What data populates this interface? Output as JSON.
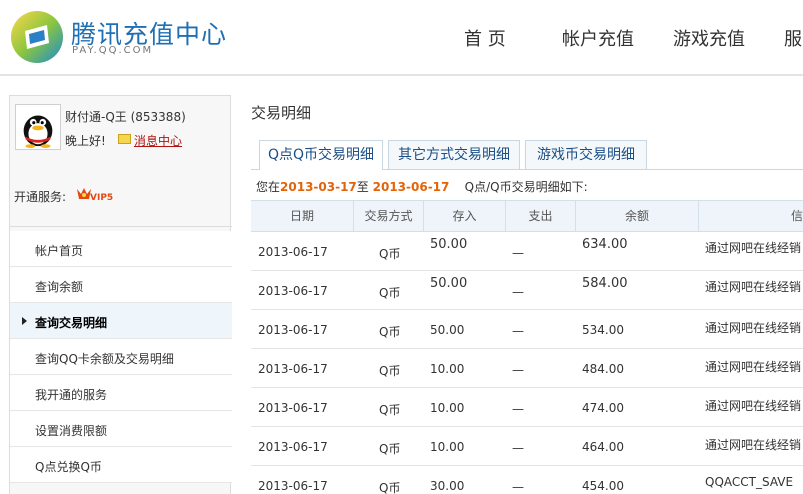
{
  "header": {
    "logo_text": "腾讯充值中心",
    "logo_sub": "PAY.QQ.COM",
    "nav": [
      "首 页",
      "帐户充值",
      "游戏充值",
      "服务"
    ]
  },
  "sidebar": {
    "user_name": "财付通-Q王 (853388)",
    "greeting": "晚上好!",
    "message_link": "消息中心",
    "service_label": "开通服务:",
    "vip_badge": "VIP5",
    "menu": [
      {
        "label": "帐户首页",
        "selected": false
      },
      {
        "label": "查询余额",
        "selected": false
      },
      {
        "label": "查询交易明细",
        "selected": true
      },
      {
        "label": "查询QQ卡余额及交易明细",
        "selected": false
      },
      {
        "label": "我开通的服务",
        "selected": false
      },
      {
        "label": "设置消费限额",
        "selected": false
      },
      {
        "label": "Q点兑换Q币",
        "selected": false
      }
    ]
  },
  "main": {
    "title": "交易明细",
    "tabs": [
      "Q点Q币交易明细",
      "其它方式交易明细",
      "游戏币交易明细"
    ],
    "date_prefix": "您在",
    "date_from": "2013-03-17",
    "date_mid": "至",
    "date_to": "2013-06-17",
    "date_suffix": "Q点/Q币交易明细如下:",
    "columns": [
      "日期",
      "交易方式",
      "存入",
      "支出",
      "余额",
      "信"
    ],
    "rows": [
      {
        "date": "2013-06-17",
        "method": "Q币",
        "deposit": "50.00",
        "withdraw": "—",
        "balance": "634.00",
        "info": "通过网吧在线经销"
      },
      {
        "date": "2013-06-17",
        "method": "Q币",
        "deposit": "50.00",
        "withdraw": "—",
        "balance": "584.00",
        "info": "通过网吧在线经销"
      },
      {
        "date": "2013-06-17",
        "method": "Q币",
        "deposit": "50.00",
        "withdraw": "—",
        "balance": "534.00",
        "info": "通过网吧在线经销"
      },
      {
        "date": "2013-06-17",
        "method": "Q币",
        "deposit": "10.00",
        "withdraw": "—",
        "balance": "484.00",
        "info": "通过网吧在线经销"
      },
      {
        "date": "2013-06-17",
        "method": "Q币",
        "deposit": "10.00",
        "withdraw": "—",
        "balance": "474.00",
        "info": "通过网吧在线经销"
      },
      {
        "date": "2013-06-17",
        "method": "Q币",
        "deposit": "10.00",
        "withdraw": "—",
        "balance": "464.00",
        "info": "通过网吧在线经销"
      },
      {
        "date": "2013-06-17",
        "method": "Q币",
        "deposit": "30.00",
        "withdraw": "—",
        "balance": "454.00",
        "info": "QQACCT_SAVE"
      }
    ]
  },
  "colors": {
    "brand_blue": "#1f6fb5",
    "date_orange": "#e2640a",
    "link_red": "#b0130f"
  }
}
